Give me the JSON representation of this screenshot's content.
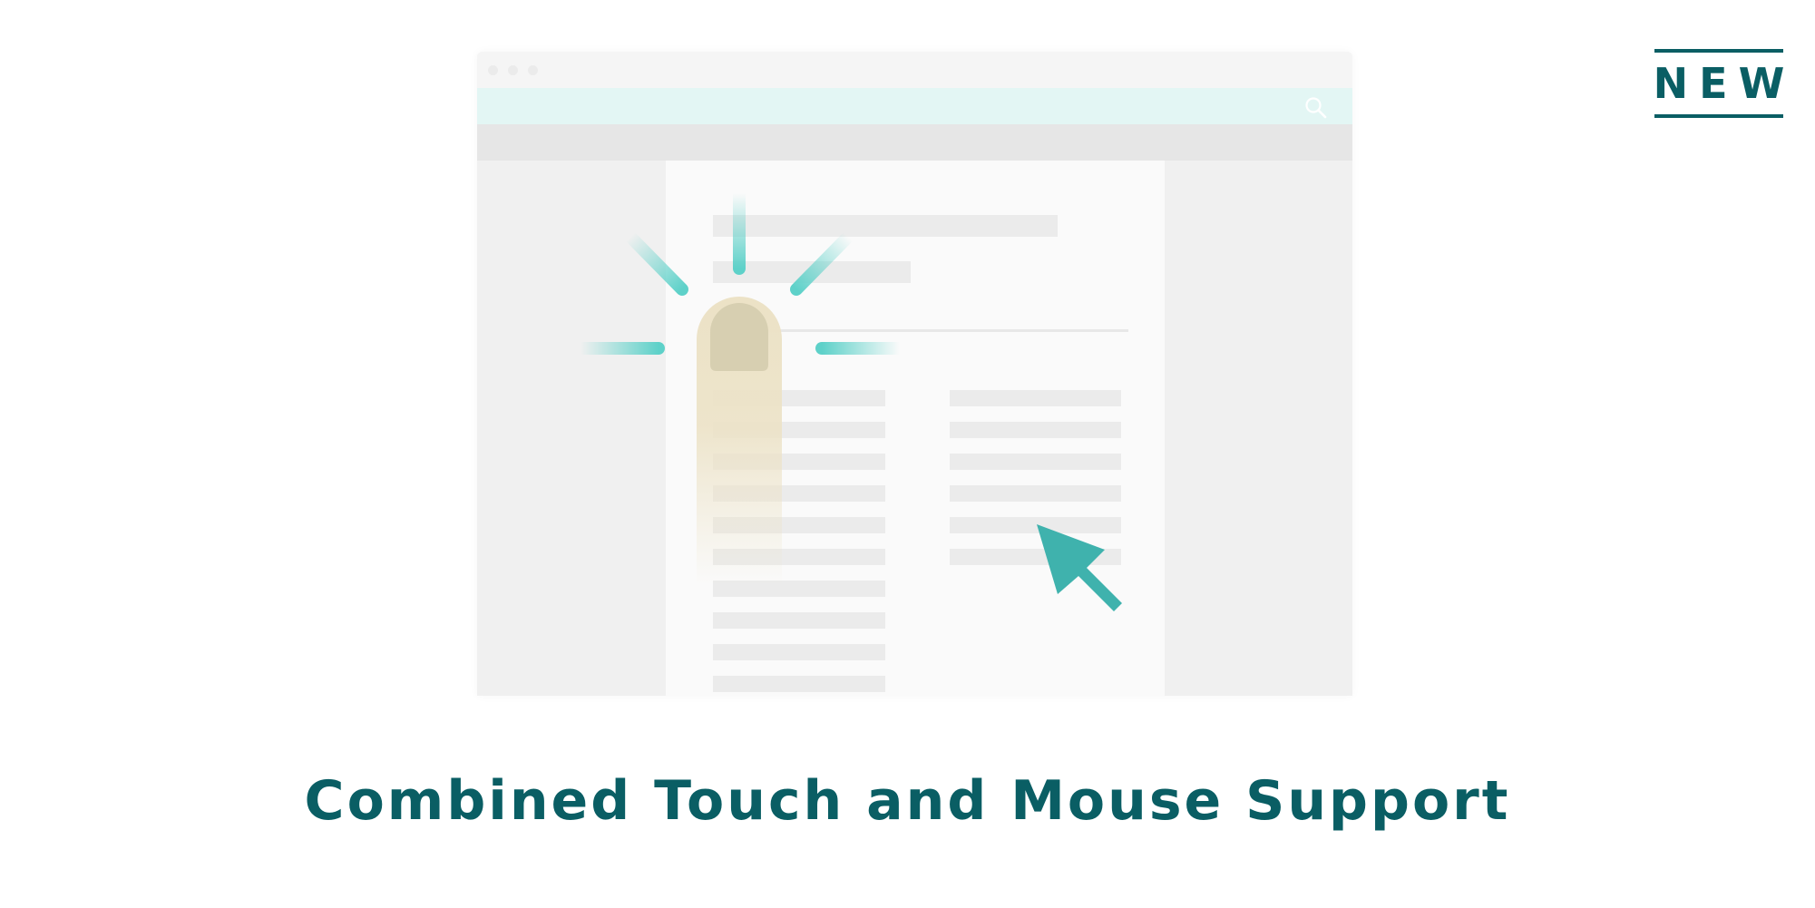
{
  "badge": {
    "label": "NEW"
  },
  "headline": {
    "text": "Combined Touch and Mouse Support"
  },
  "colors": {
    "brand": "#0a5e64",
    "accent": "#3fb2ad",
    "tap_ray": "#5ed1c9",
    "finger": "#ece2c6",
    "nail": "#d7cfb1"
  },
  "icons": {
    "search": "search-icon",
    "pointer": "mouse-cursor-icon",
    "touch": "finger-touch-icon"
  }
}
